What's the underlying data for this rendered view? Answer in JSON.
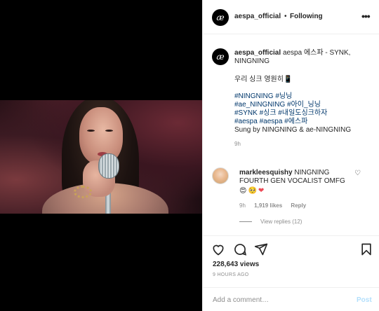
{
  "post": {
    "username": "aespa_official",
    "separator": "•",
    "follow_status": "Following",
    "more_label": "•••"
  },
  "caption": {
    "username": "aespa_official",
    "title": "aespa 에스파 - SYNK, NINGNING",
    "line2": "우리 싱크 영원히📱",
    "hashtags_line1": "#NINGNING #닝닝",
    "hashtags_line2": "#ae_NINGNING #아이_닝닝",
    "hashtags_line3": "#SYNK #싱크 #내일도싱크하자",
    "hashtags_line4": "#aespa #aespa #에스파",
    "sung_by": "Sung by NINGNING & ae-NINGNING",
    "time": "9h"
  },
  "comment": {
    "username": "markleesquishy",
    "text": "NINGNING FOURTH GEN VOCALIST OMFG",
    "emojis": [
      "😍",
      "🥺",
      "❤"
    ],
    "time": "9h",
    "likes": "1,919 likes",
    "reply_label": "Reply",
    "view_replies": "View replies (12)"
  },
  "stats": {
    "views": "228,643 views",
    "posted": "9 HOURS AGO"
  },
  "composer": {
    "placeholder": "Add a comment…",
    "post_label": "Post"
  },
  "icons": [
    "heart-icon",
    "comment-icon",
    "share-icon",
    "bookmark-icon",
    "more-icon"
  ],
  "colors": {
    "hashtag": "#00376b",
    "muted": "#8e8e8e",
    "post_button": "#b2dffc",
    "like_heart": "#ed4956"
  }
}
